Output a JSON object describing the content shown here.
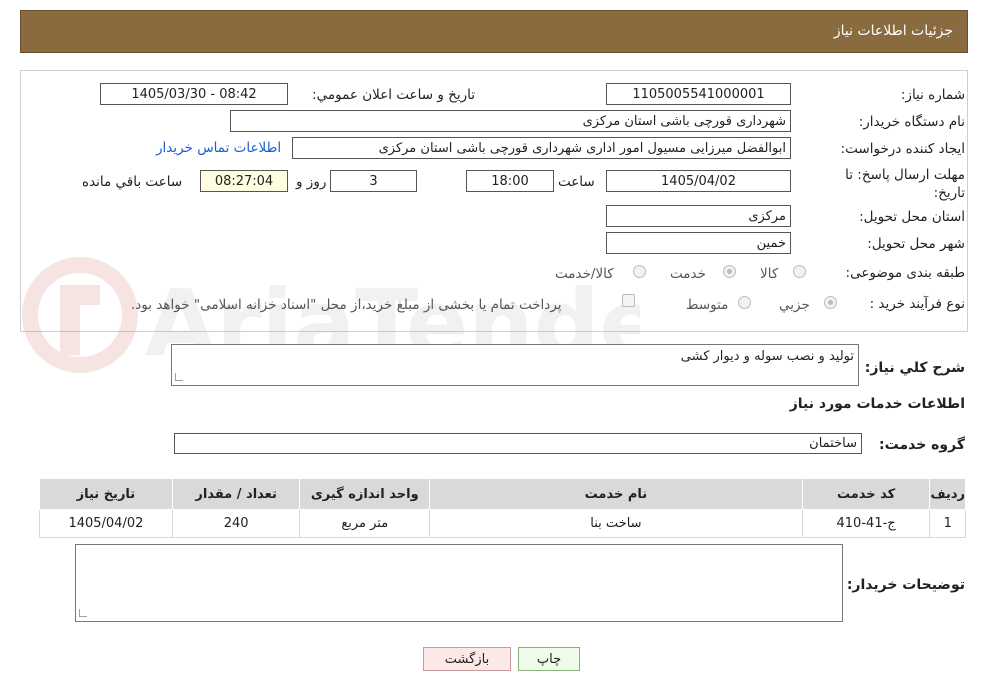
{
  "header": {
    "title": "جزئیات اطلاعات نیاز"
  },
  "form": {
    "need_number_label": "شماره نیاز:",
    "need_number": "1105005541000001",
    "announce_label": "تاریخ و ساعت اعلان عمومي:",
    "announce_value": "1405/03/30 - 08:42",
    "buyer_org_label": "نام دستگاه خریدار:",
    "buyer_org": "شهرداری قورچی باشی استان مرکزی",
    "creator_label": "ایجاد کننده درخواست:",
    "creator": "ابوالفضل  میرزایی  مسیول امور اداری  شهرداری قورچی باشی استان مرکزی",
    "contact_link": "اطلاعات تماس خریدار",
    "deadline_label": "مهلت ارسال پاسخ: تا تاریخ:",
    "deadline_date": "1405/04/02",
    "time_label": "ساعت",
    "deadline_time": "18:00",
    "days": "3",
    "days_label": "روز و",
    "remaining": "08:27:04",
    "remaining_label": "ساعت باقي مانده",
    "province_label": "استان محل تحویل:",
    "province": "مرکزی",
    "city_label": "شهر محل تحویل:",
    "city": "خمین",
    "category_label": "طبقه بندی موضوعی:",
    "category_options": [
      "کالا",
      "خدمت",
      "کالا/خدمت"
    ],
    "process_label": "نوع فرآیند خرید :",
    "process_options": [
      "جزیي",
      "متوسط"
    ],
    "payment_note": "پرداخت تمام یا بخشی از مبلغ خرید،از محل \"اسناد خزانه اسلامی\" خواهد بود."
  },
  "summary": {
    "label": "شرح کلي نیاز:",
    "value": "تولید و نصب سوله و دیوار کشی"
  },
  "services": {
    "title": "اطلاعات خدمات مورد نیاز",
    "group_label": "گروه خدمت:",
    "group_value": "ساختمان",
    "columns": [
      "ردیف",
      "کد خدمت",
      "نام خدمت",
      "واحد اندازه گیری",
      "تعداد / مقدار",
      "تاریخ نیاز"
    ],
    "rows": [
      [
        "1",
        "ج-41-410",
        "ساخت بنا",
        "متر مربع",
        "240",
        "1405/04/02"
      ]
    ]
  },
  "notes": {
    "label": "توضیحات خریدار:"
  },
  "buttons": {
    "print": "چاپ",
    "back": "بازگشت"
  },
  "watermark": {
    "text": "AriaTender.neT"
  }
}
